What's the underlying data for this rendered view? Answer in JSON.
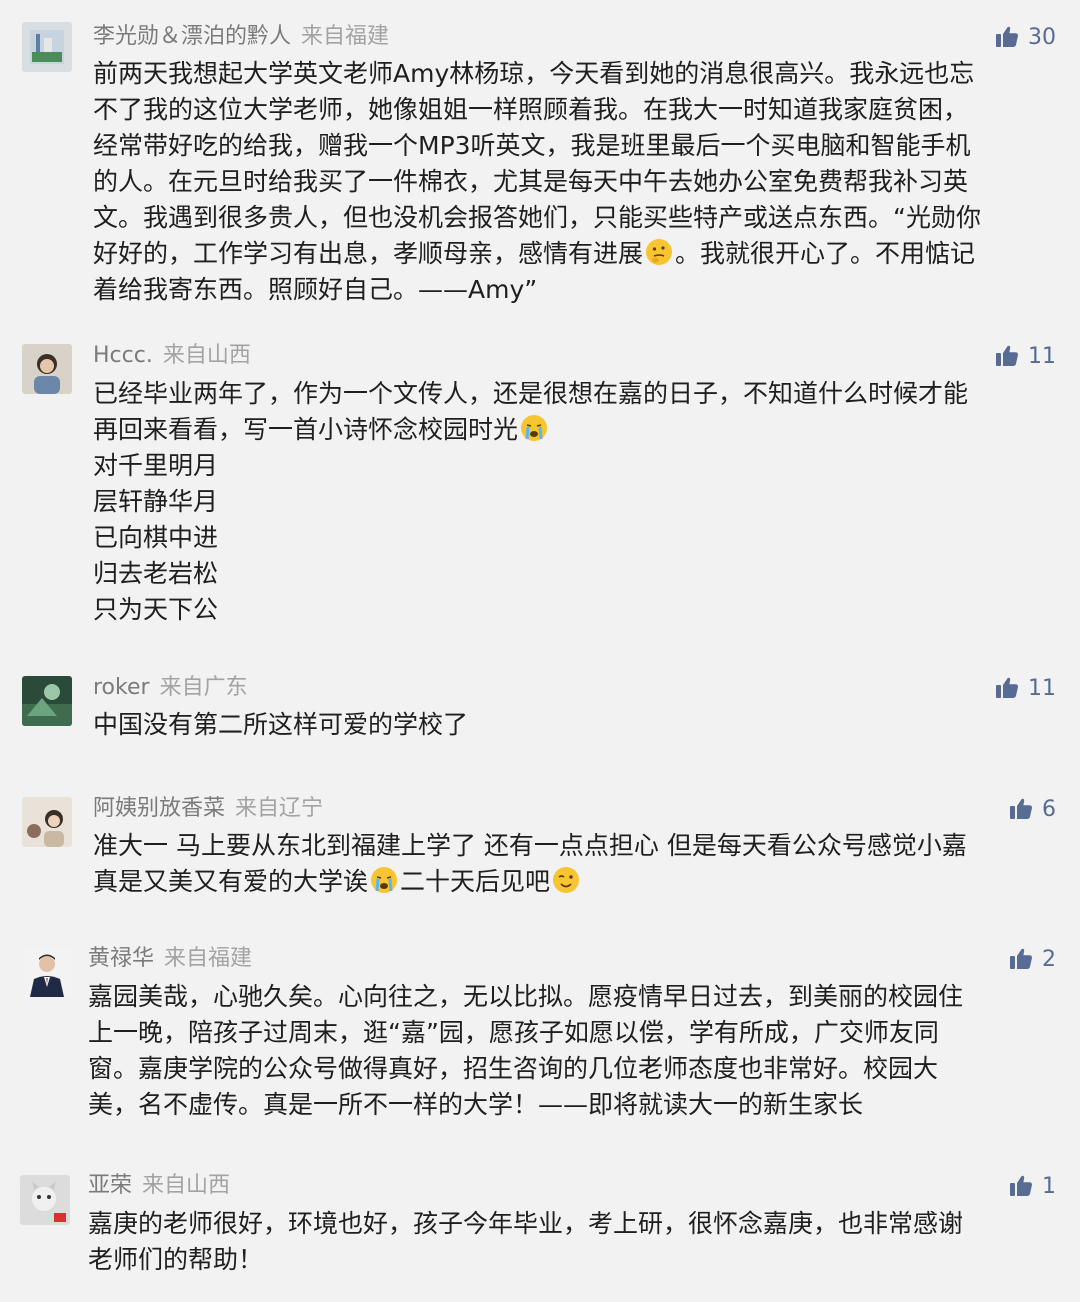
{
  "comments": [
    {
      "nickname": "李光勋＆漂泊的黔人",
      "region": "来自福建",
      "likes": "30",
      "lines": [
        "前两天我想起大学英文老师Amy林杨琼，今天看到她的消息很高兴。我永远也忘",
        "不了我的这位大学老师，她像姐姐一样照顾着我。在我大一时知道我家庭贫困，",
        "经常带好吃的给我，赠我一个MP3听英文，我是班里最后一个买电脑和智能手机",
        "的人。在元旦时给我买了一件棉衣，尤其是每天中午去她办公室免费帮我补习英",
        "文。我遇到很多贵人，但也没机会报答她们，只能买些特产或送点东西。“光勋你"
      ],
      "line6_before": "好好的，工作学习有出息，孝顺母亲，感情有进展",
      "line6_emoji": "thinking-face-emoji",
      "line6_after": "。我就很开心了。不用惦记",
      "line7": "着给我寄东西。照顾好自己。——Amy”"
    },
    {
      "nickname": "Hccc.",
      "region": "来自山西",
      "likes": "11",
      "line1": "已经毕业两年了，作为一个文传人，还是很想在嘉的日子，不知道什么时候才能",
      "line2_before": "再回来看看，写一首小诗怀念校园时光",
      "line2_emoji": "crying-face-emoji",
      "poem": [
        "对千里明月",
        "层轩静华月",
        "已向棋中进",
        "归去老岩松",
        "只为天下公"
      ]
    },
    {
      "nickname": "roker",
      "region": "来自广东",
      "likes": "11",
      "line1": "中国没有第二所这样可爱的学校了"
    },
    {
      "nickname": "阿姨别放香菜",
      "region": "来自辽宁",
      "likes": "6",
      "line1": "准大一 马上要从东北到福建上学了 还有一点点担心 但是每天看公众号感觉小嘉",
      "line2_before": "真是又美又有爱的大学诶",
      "line2_emoji1": "crying-face-emoji",
      "line2_mid": "二十天后见吧",
      "line2_emoji2": "wink-face-emoji"
    },
    {
      "nickname": "黄禄华",
      "region": "来自福建",
      "likes": "2",
      "lines": [
        "嘉园美哉，心驰久矣。心向往之，无以比拟。愿疫情早日过去，到美丽的校园住",
        "上一晚，陪孩子过周末，逛“嘉”园，愿孩子如愿以偿，学有所成，广交师友同",
        "窗。嘉庚学院的公众号做得真好，招生咨询的几位老师态度也非常好。校园大",
        "美，名不虚传。真是一所不一样的大学！——即将就读大一的新生家长"
      ]
    },
    {
      "nickname": "亚荣",
      "region": "来自山西",
      "likes": "1",
      "lines": [
        "嘉庚的老师很好，环境也好，孩子今年毕业，考上研，很怀念嘉庚，也非常感谢",
        "老师们的帮助！"
      ]
    }
  ],
  "colors": {
    "background": "#f2f2f2",
    "nickname": "#7b7b7b",
    "region": "#a3a3a3",
    "like": "#576b95",
    "text": "#1f1f1f"
  },
  "icons": {
    "like": "thumbs-up-icon"
  }
}
